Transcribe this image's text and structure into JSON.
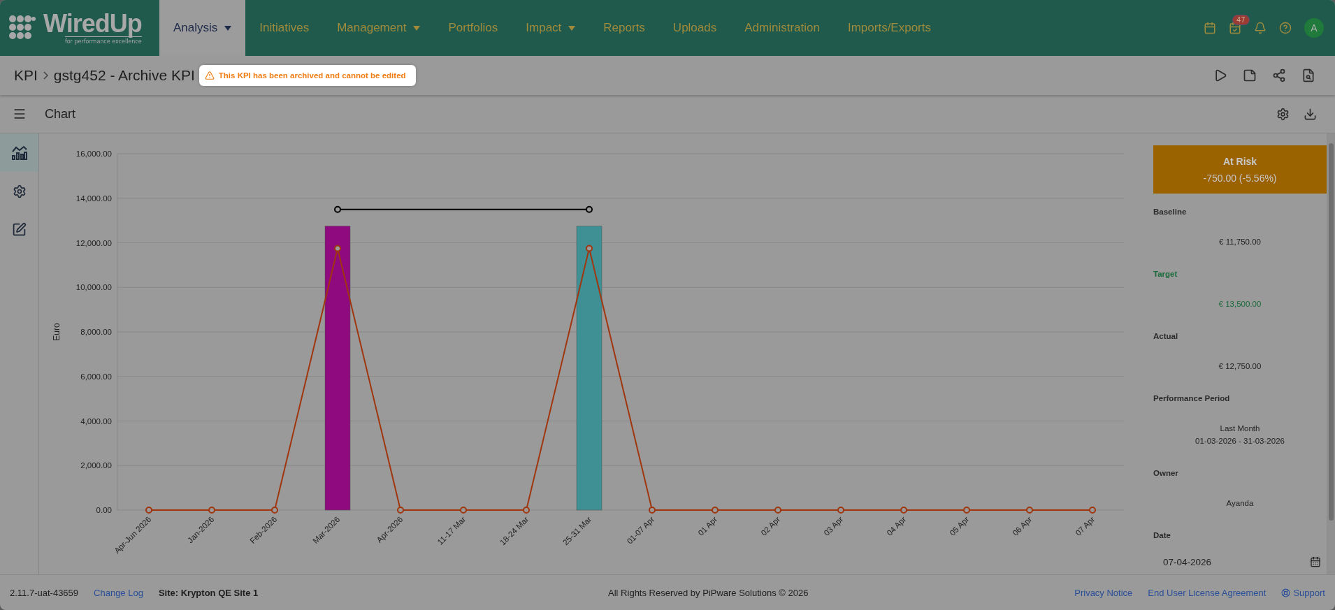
{
  "logo": {
    "name": "WiredUp",
    "tagline": "for performance excellence"
  },
  "nav": [
    {
      "label": "Analysis",
      "selected": true,
      "dropdown": true
    },
    {
      "label": "Initiatives",
      "selected": false,
      "dropdown": false
    },
    {
      "label": "Management",
      "selected": false,
      "dropdown": true
    },
    {
      "label": "Portfolios",
      "selected": false,
      "dropdown": false
    },
    {
      "label": "Impact",
      "selected": false,
      "dropdown": true
    },
    {
      "label": "Reports",
      "selected": false,
      "dropdown": false
    },
    {
      "label": "Uploads",
      "selected": false,
      "dropdown": false
    },
    {
      "label": "Administration",
      "selected": false,
      "dropdown": false
    },
    {
      "label": "Imports/Exports",
      "selected": false,
      "dropdown": false
    }
  ],
  "header_icons": [
    {
      "kind": "calendar"
    },
    {
      "kind": "tasks",
      "badge": "47"
    },
    {
      "kind": "bell"
    },
    {
      "kind": "help"
    }
  ],
  "avatar": "A",
  "breadcrumb": [
    "KPI",
    "gstg452 - Archive KPI"
  ],
  "warning": "This KPI has been archived and cannot be edited",
  "section_title": "Chart",
  "side_tools": [
    {
      "kind": "chart",
      "selected": true
    },
    {
      "kind": "settings",
      "selected": false
    },
    {
      "kind": "edit",
      "selected": false
    }
  ],
  "chart": {
    "chart_data": {
      "type": "bar",
      "ylabel": "Euro",
      "categories": [
        "Apr-Jun 2026",
        "Jan-2026",
        "Feb-2026",
        "Mar-2026",
        "Apr-2026",
        "11-17 Mar",
        "18-24 Mar",
        "25-31 Mar",
        "01-07 Apr",
        "01 Apr",
        "02 Apr",
        "03 Apr",
        "04 Apr",
        "05 Apr",
        "06 Apr",
        "07 Apr"
      ],
      "ylim": [
        0,
        16000
      ],
      "grid": true,
      "yticks": [
        {
          "value": 0,
          "label": "0.00"
        },
        {
          "value": 2000,
          "label": "2,000.00"
        },
        {
          "value": 4000,
          "label": "4,000.00"
        },
        {
          "value": 6000,
          "label": "6,000.00"
        },
        {
          "value": 8000,
          "label": "8,000.00"
        },
        {
          "value": 10000,
          "label": "10,000.00"
        },
        {
          "value": 12000,
          "label": "12,000.00"
        },
        {
          "value": 14000,
          "label": "14,000.00"
        },
        {
          "value": 16000,
          "label": "16,000.00"
        }
      ],
      "series": [
        {
          "type": "bar",
          "color": "#8e0a7e",
          "values": [
            null,
            null,
            null,
            12750,
            null,
            null,
            null,
            null,
            null,
            null,
            null,
            null,
            null,
            null,
            null,
            null
          ]
        },
        {
          "type": "bar",
          "color": "#3f9095",
          "values": [
            null,
            null,
            null,
            null,
            null,
            null,
            null,
            12750,
            null,
            null,
            null,
            null,
            null,
            null,
            null,
            null
          ]
        },
        {
          "type": "line",
          "color": "#a0360e",
          "marker": "circle",
          "values": [
            0,
            0,
            0,
            11750,
            0,
            0,
            0,
            11750,
            0,
            0,
            0,
            0,
            0,
            0,
            0,
            0
          ]
        },
        {
          "type": "line",
          "color": "#000000",
          "marker": "circle",
          "values": [
            null,
            null,
            null,
            13500,
            null,
            null,
            null,
            13500,
            null,
            null,
            null,
            null,
            null,
            null,
            null,
            null
          ]
        }
      ]
    }
  },
  "status": {
    "label": "At Risk",
    "value": "-750.00 (-5.56%)"
  },
  "details": [
    {
      "label": "Baseline",
      "values": [
        "€ 11,750.00"
      ],
      "accent": false
    },
    {
      "label": "Target",
      "values": [
        "€ 13,500.00"
      ],
      "accent": true
    },
    {
      "label": "Actual",
      "values": [
        "€ 12,750.00"
      ],
      "accent": false
    },
    {
      "label": "Performance Period",
      "values": [
        "Last Month",
        "01-03-2026 - 31-03-2026"
      ],
      "accent": false
    },
    {
      "label": "Owner",
      "values": [
        "Ayanda"
      ],
      "accent": false
    }
  ],
  "date": {
    "label": "Date",
    "value": "07-04-2026"
  },
  "footer": {
    "version": "2.11.7-uat-43659",
    "changelog": "Change Log",
    "site": "Site: Krypton QE Site 1",
    "copyright": "All Rights Reserved by PiPware Solutions © 2026",
    "links": [
      "Privacy Notice",
      "End User License Agreement",
      "Support"
    ]
  }
}
